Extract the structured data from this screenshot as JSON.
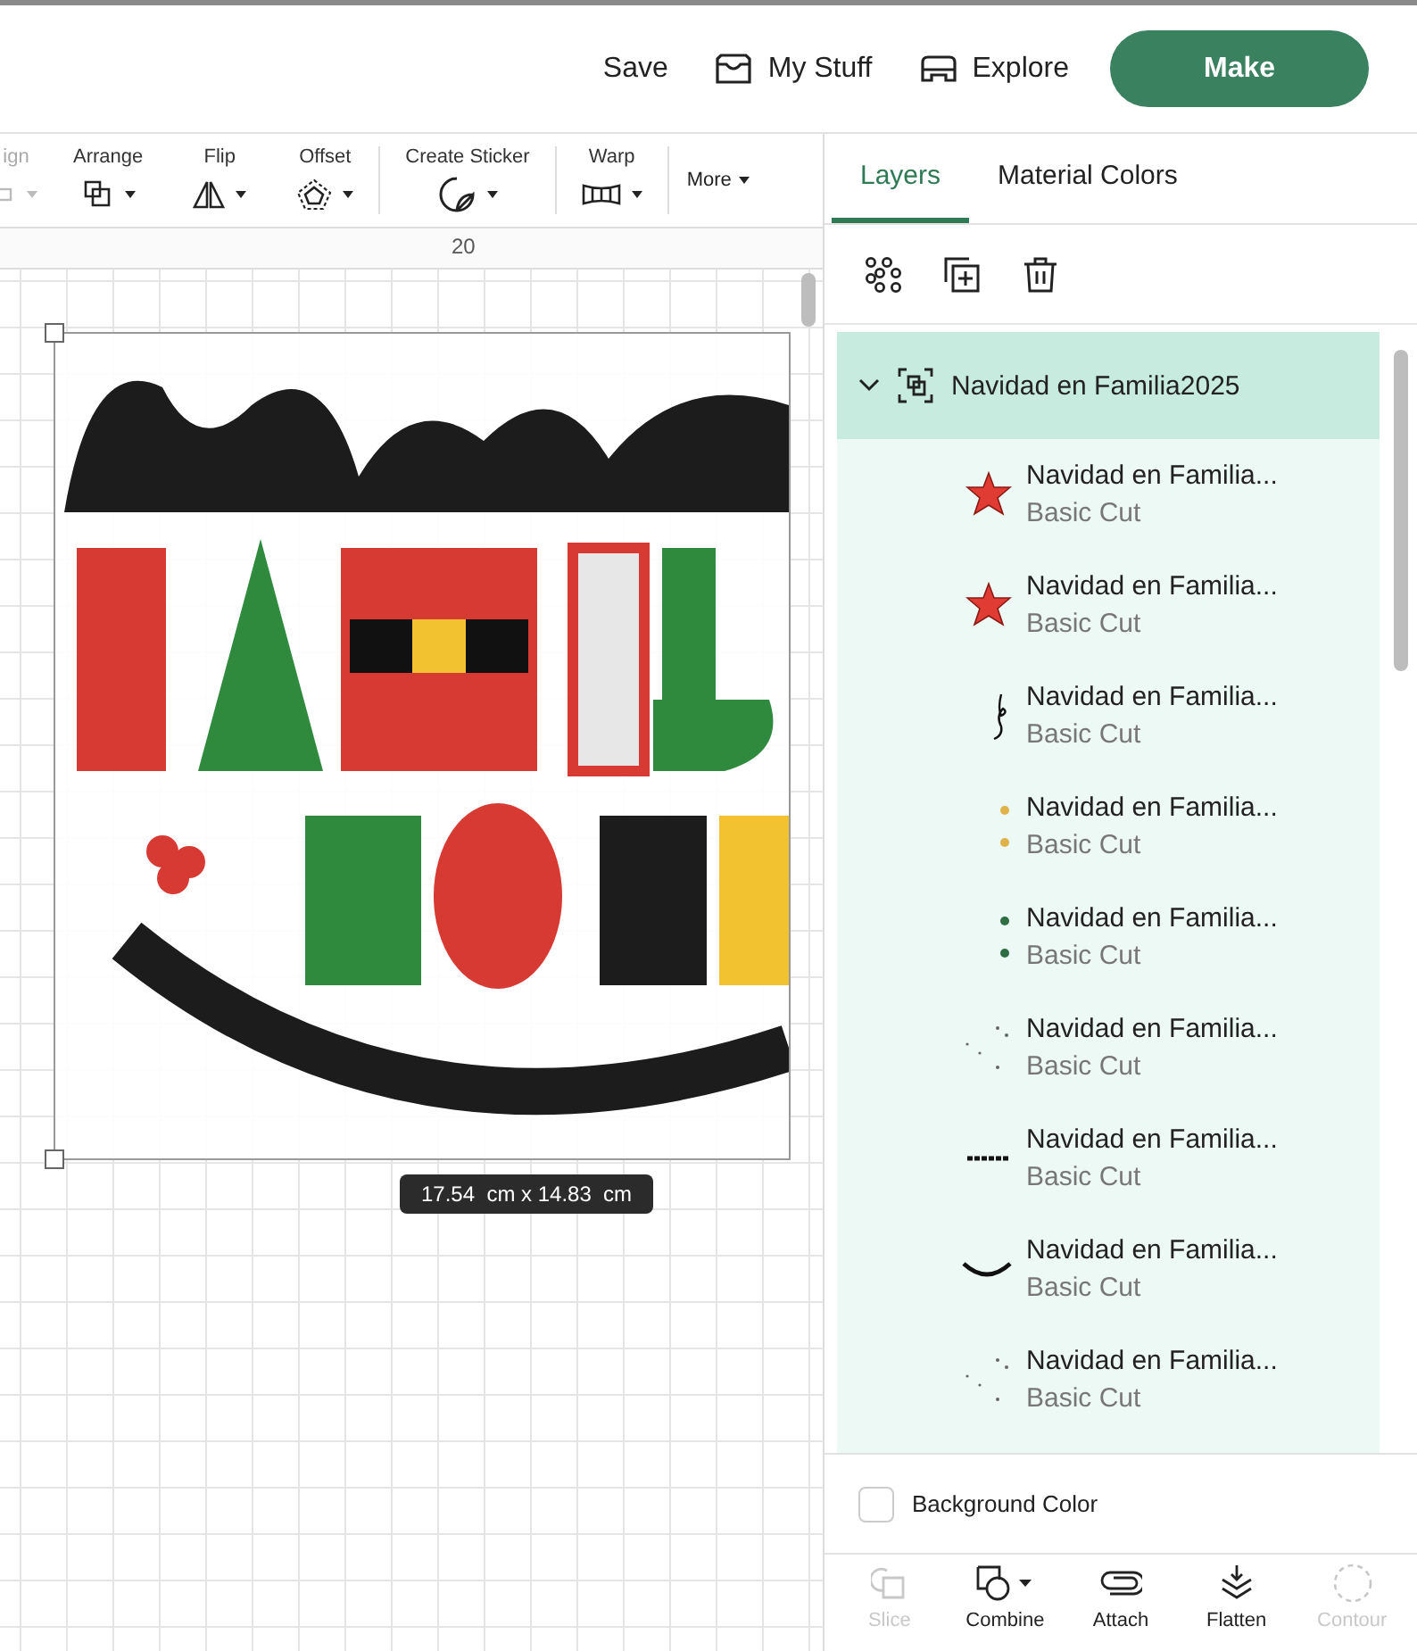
{
  "top_bar": {
    "links": [
      {
        "label": "Save",
        "kind": "plain"
      },
      {
        "label": "My Stuff",
        "kind": "inbox"
      },
      {
        "label": "Explore",
        "kind": "explore"
      }
    ],
    "make_button": "Make"
  },
  "toolbar": {
    "tools": [
      {
        "label": "ign",
        "kind": "align",
        "disabled": true
      },
      {
        "label": "Arrange",
        "kind": "arrange",
        "disabled": false
      },
      {
        "label": "Flip",
        "kind": "flip",
        "disabled": false
      },
      {
        "label": "Offset",
        "kind": "offset",
        "disabled": false
      },
      {
        "label": "Create Sticker",
        "kind": "sticker",
        "disabled": false
      },
      {
        "label": "Warp",
        "kind": "warp",
        "disabled": false
      }
    ],
    "more": "More"
  },
  "canvas": {
    "ruler_mark": "20",
    "size_tooltip": "17.54  cm x 14.83  cm"
  },
  "panel": {
    "tabs": [
      {
        "label": "Layers",
        "selected": true
      },
      {
        "label": "Material Colors",
        "selected": false
      }
    ],
    "group": {
      "name": "Navidad en Familia2025",
      "expanded": true,
      "children": [
        {
          "name": "Navidad en Familia...",
          "operation": "Basic Cut",
          "kind": "star"
        },
        {
          "name": "Navidad en Familia...",
          "operation": "Basic Cut",
          "kind": "star"
        },
        {
          "name": "Navidad en Familia...",
          "operation": "Basic Cut",
          "kind": "swirl"
        },
        {
          "name": "Navidad en Familia...",
          "operation": "Basic Cut",
          "kind": "yellow-dots"
        },
        {
          "name": "Navidad en Familia...",
          "operation": "Basic Cut",
          "kind": "green-dots"
        },
        {
          "name": "Navidad en Familia...",
          "operation": "Basic Cut",
          "kind": "scatter"
        },
        {
          "name": "Navidad en Familia...",
          "operation": "Basic Cut",
          "kind": "text"
        },
        {
          "name": "Navidad en Familia...",
          "operation": "Basic Cut",
          "kind": "arc"
        },
        {
          "name": "Navidad en Familia...",
          "operation": "Basic Cut",
          "kind": "scatter"
        }
      ]
    },
    "background_color": {
      "label": "Background Color",
      "checked": false
    },
    "actions": [
      {
        "label": "Slice",
        "kind": "slice",
        "disabled": true
      },
      {
        "label": "Combine",
        "kind": "combine",
        "disabled": false
      },
      {
        "label": "Attach",
        "kind": "attach",
        "disabled": false
      },
      {
        "label": "Flatten",
        "kind": "flatten",
        "disabled": false
      },
      {
        "label": "Contour",
        "kind": "contour",
        "disabled": true
      }
    ]
  }
}
